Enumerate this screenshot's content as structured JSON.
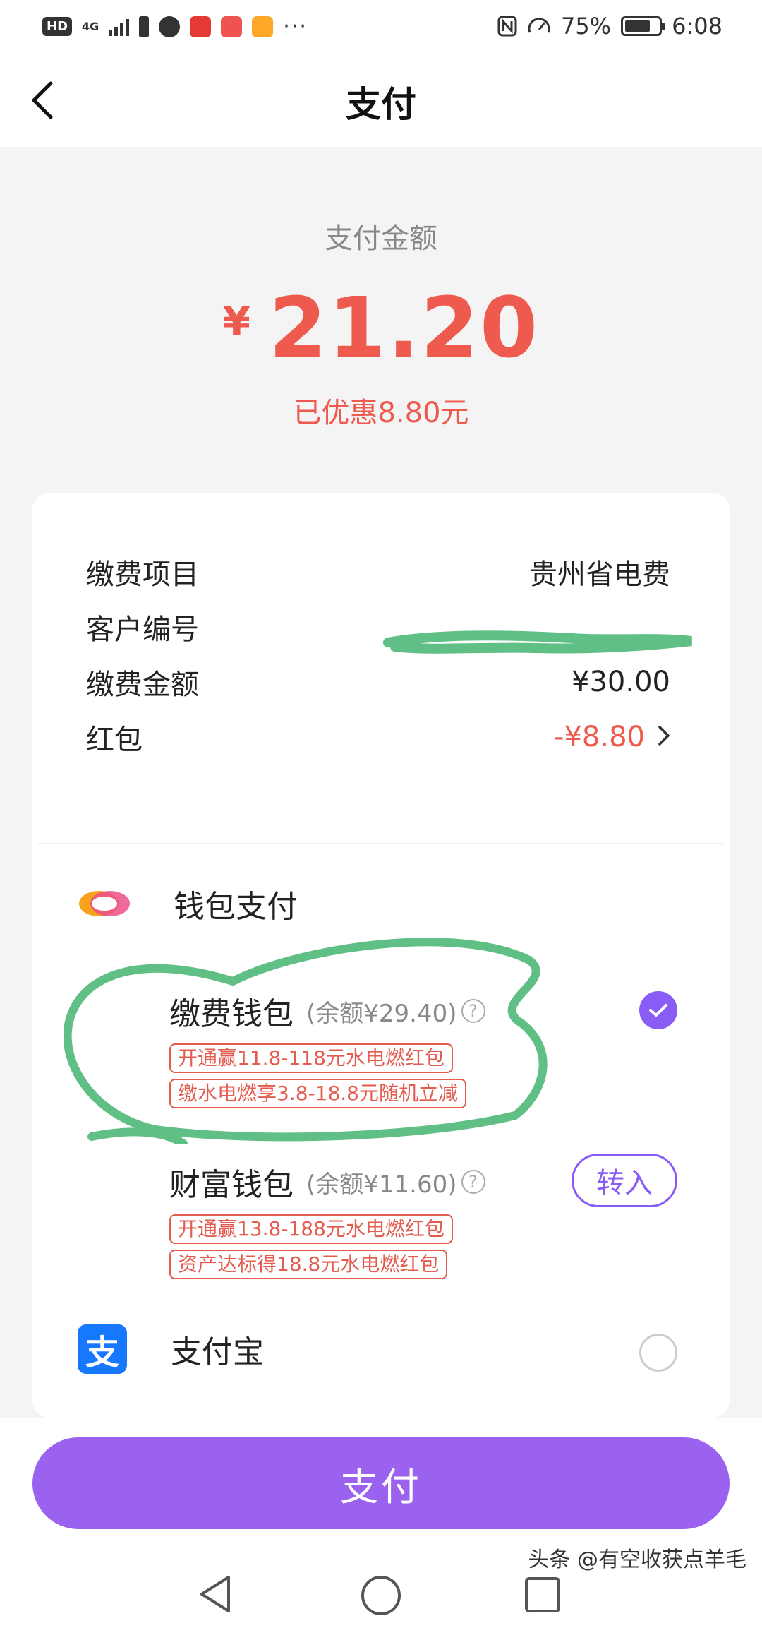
{
  "status_bar": {
    "hd": "HD",
    "network": "4G",
    "battery": "75%",
    "battery_level": 0.75,
    "time": "6:08",
    "more": "···"
  },
  "header": {
    "title": "支付"
  },
  "summary": {
    "label": "支付金额",
    "currency": "¥",
    "amount": "21.20",
    "discount": "已优惠8.80元"
  },
  "details": [
    {
      "label": "缴费项目",
      "value": "贵州省电费"
    },
    {
      "label": "客户编号",
      "value": ""
    },
    {
      "label": "缴费金额",
      "value": "¥30.00"
    },
    {
      "label": "红包",
      "value": "-¥8.80"
    }
  ],
  "wallet": {
    "title": "钱包支付",
    "options": [
      {
        "name": "缴费钱包",
        "balance": "(余额¥29.40)",
        "tags": [
          "开通赢11.8-118元水电燃红包",
          "缴水电燃享3.8-18.8元随机立减"
        ]
      },
      {
        "name": "财富钱包",
        "balance": "(余额¥11.60)",
        "tags": [
          "开通赢13.8-188元水电燃红包",
          "资产达标得18.8元水电燃红包"
        ],
        "action": "转入"
      }
    ]
  },
  "alipay": {
    "name": "支付宝",
    "logo_char": "支"
  },
  "pay_button": "支付",
  "watermark": "头条 @有空收获点羊毛",
  "colors": {
    "accent_purple": "#8a5cf6",
    "pay_button": "#9b62ef",
    "price_red": "#ef5a4e",
    "scribble_green": "#5fbf85",
    "alipay_blue": "#1677ff"
  }
}
